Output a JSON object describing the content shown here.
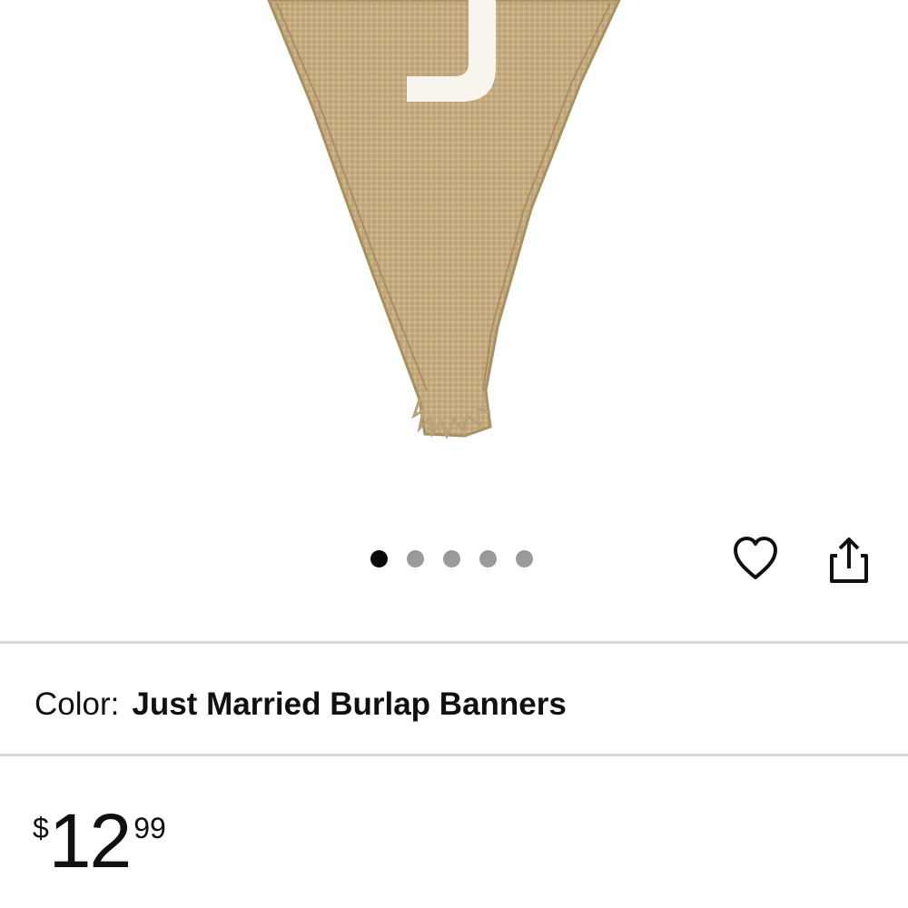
{
  "product_image": {
    "alt": "Just Married Burlap Banners",
    "pennant_letter": "J",
    "fabric_color": "#c8ae84",
    "letter_color": "#f7f5ee"
  },
  "carousel": {
    "total": 5,
    "active_index": 0
  },
  "actions": {
    "wishlist_icon": "heart-outline-icon",
    "share_icon": "share-icon"
  },
  "color": {
    "label": "Color:",
    "value": "Just Married Burlap Banners"
  },
  "price": {
    "symbol": "$",
    "whole": "12",
    "fraction": "99"
  }
}
